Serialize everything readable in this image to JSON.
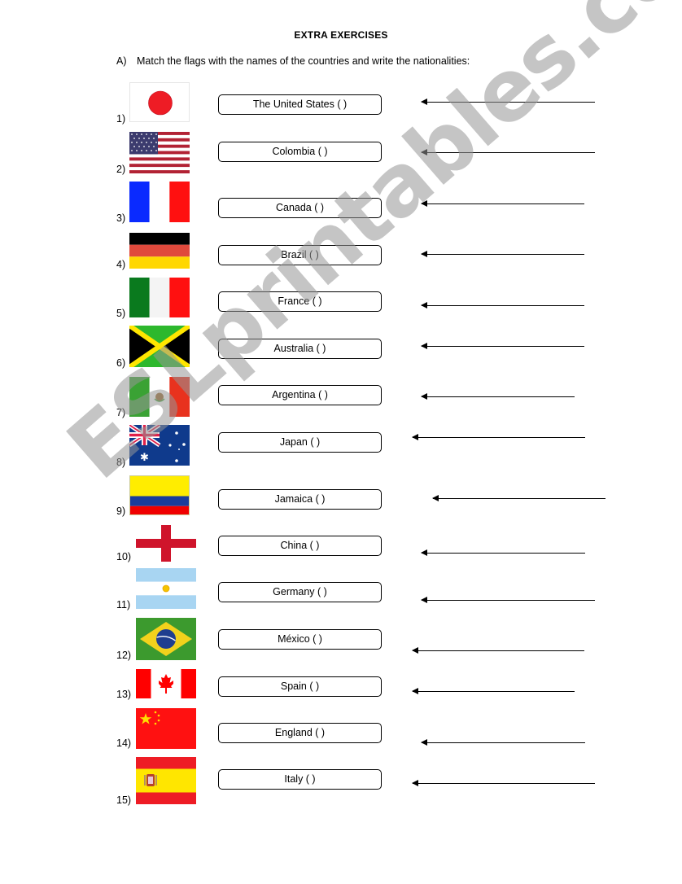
{
  "document": {
    "title": "EXTRA EXERCISES",
    "section_label": "A)",
    "instruction": "Match the flags with the names of the countries and write the nationalities:",
    "watermark": "ESLprintables.com"
  },
  "rows": [
    {
      "number": "1)",
      "flag": "japan-flag",
      "country_box": "The United States (      )"
    },
    {
      "number": "2)",
      "flag": "united-states-flag",
      "country_box": "Colombia (      )"
    },
    {
      "number": "3)",
      "flag": "france-flag",
      "country_box": "Canada (      )"
    },
    {
      "number": "4)",
      "flag": "germany-flag",
      "country_box": "Brazil (      )"
    },
    {
      "number": "5)",
      "flag": "italy-flag",
      "country_box": "France (      )"
    },
    {
      "number": "6)",
      "flag": "jamaica-flag",
      "country_box": "Australia (      )"
    },
    {
      "number": "7)",
      "flag": "mexico-flag",
      "country_box": "Argentina (      )"
    },
    {
      "number": "8)",
      "flag": "australia-flag",
      "country_box": "Japan (      )"
    },
    {
      "number": "9)",
      "flag": "colombia-flag",
      "country_box": "Jamaica (      )"
    },
    {
      "number": "10)",
      "flag": "england-flag",
      "country_box": "China (      )"
    },
    {
      "number": "11)",
      "flag": "argentina-flag",
      "country_box": "Germany (      )"
    },
    {
      "number": "12)",
      "flag": "brazil-flag",
      "country_box": "México (      )"
    },
    {
      "number": "13)",
      "flag": "canada-flag",
      "country_box": "Spain (      )"
    },
    {
      "number": "14)",
      "flag": "china-flag",
      "country_box": "England (      )"
    },
    {
      "number": "15)",
      "flag": "spain-flag",
      "country_box": "Italy (      )"
    }
  ],
  "colors": {
    "red": "#ff0000",
    "blue": "#0a2aff",
    "watermark": "#969696"
  }
}
